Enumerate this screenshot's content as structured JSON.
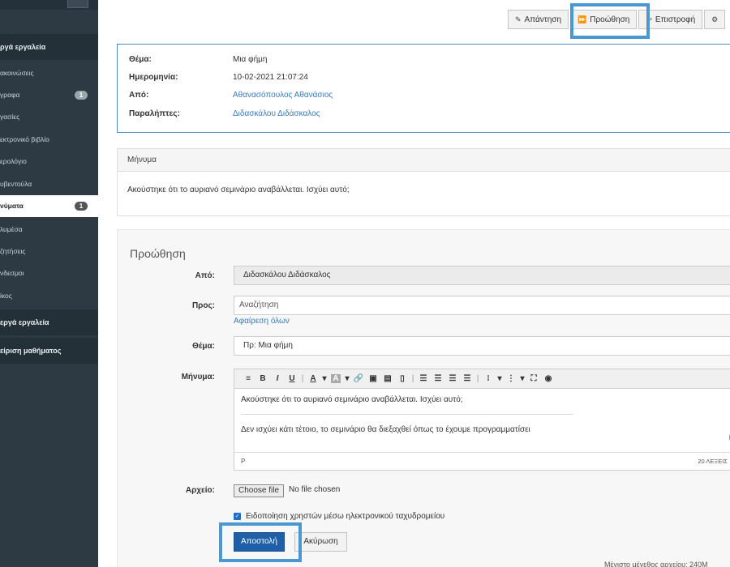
{
  "sidebar": {
    "headers": [
      "ργά εργαλεία",
      "εργά εργαλεία",
      "είριση μαθήματος"
    ],
    "items": [
      {
        "label": "ακοινώσεις",
        "badge": ""
      },
      {
        "label": "γραφα",
        "badge": "1"
      },
      {
        "label": "γασίες",
        "badge": ""
      },
      {
        "label": "εκτρονικό βιβλίο",
        "badge": ""
      },
      {
        "label": "ερολόγιο",
        "badge": ""
      },
      {
        "label": "υβεντούλα",
        "badge": ""
      },
      {
        "label": "νύματα",
        "badge": "1",
        "active": true
      },
      {
        "label": "λυμέσα",
        "badge": ""
      },
      {
        "label": "ζητήσεις",
        "badge": ""
      },
      {
        "label": "νδεσμοι",
        "badge": ""
      },
      {
        "label": "ίκος",
        "badge": ""
      }
    ]
  },
  "toolbar": {
    "reply": "Απάντηση",
    "forward": "Προώθηση",
    "back": "Επιστροφή"
  },
  "info": {
    "subject_label": "Θέμα:",
    "subject": "Μια φήμη",
    "date_label": "Ημερομηνία:",
    "date": "10-02-2021 21:07:24",
    "from_label": "Από:",
    "from": "Αθανασόπουλος Αθανάσιος",
    "recipients_label": "Παραλήπτες:",
    "recipients": "Διδασκάλου Διδάσκαλος"
  },
  "message": {
    "heading": "Μήνυμα",
    "body": "Ακούστηκε ότι το αυριανό σεμινάριο αναβάλλεται. Ισχύει αυτό;"
  },
  "forward_form": {
    "title": "Προώθηση",
    "from_label": "Από:",
    "from_value": "Διδασκάλου Διδάσκαλος",
    "to_label": "Προς:",
    "to_placeholder": "Αναζήτηση",
    "remove_all": "Αφαίρεση όλων",
    "subject_label": "Θέμα:",
    "subject_value": "Πρ: Μια φήμη",
    "message_label": "Μήνυμα:",
    "editor_quoted": "Ακούστηκε ότι το αυριανό σεμινάριο αναβάλλεται. Ισχύει αυτό;",
    "editor_reply": "Δεν ισχύει κάτι τέτοιο, το σεμινάριο θα διεξαχθεί όπως το έχουμε προγραμματίσει",
    "editor_path": "P",
    "editor_wordcount": "20 ΛΕΞΕΙΣ",
    "file_label": "Αρχείο:",
    "file_button": "Choose file",
    "file_status": "No file chosen",
    "notify_label": "Ειδοποίηση χρηστών μέσω ηλεκτρονικού ταχυδρομείου",
    "send_button": "Αποστολή",
    "cancel_button": "Ακύρωση"
  },
  "footer_note": "Μέγιστο μέγεθος αρχείου: 240M",
  "colors": {
    "sidebar_bg": "#2d3a44",
    "accent_blue": "#4a97d2",
    "primary_button": "#1f5fa8",
    "link": "#3a7bbd"
  }
}
